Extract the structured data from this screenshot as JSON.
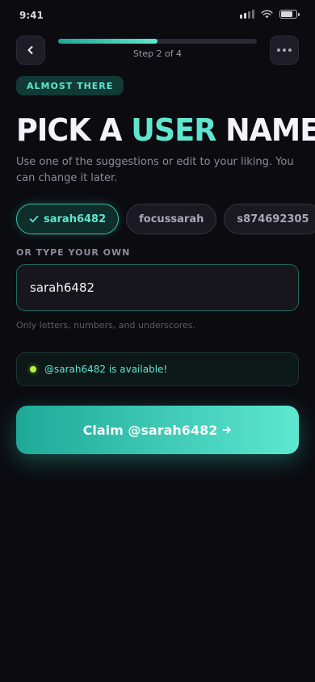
{
  "status_bar": {
    "time": "9:41"
  },
  "header": {
    "step_label": "Step 2 of 4",
    "progress_fraction": 0.5
  },
  "badge": {
    "label": "ALMOST THERE"
  },
  "title": {
    "part1": "PICK A ",
    "accent": "USER",
    "part2": " NAME"
  },
  "subtitle": "Use one of the suggestions or edit to your liking. You can change it later.",
  "suggestions": [
    {
      "label": "sarah6482",
      "selected": true
    },
    {
      "label": "focussarah",
      "selected": false
    },
    {
      "label": "s874692305",
      "selected": false
    }
  ],
  "custom": {
    "label": "OR TYPE YOUR OWN",
    "value": "sarah6482",
    "hint": "Only letters, numbers, and underscores."
  },
  "availability": {
    "text": "@sarah6482 is available!"
  },
  "cta": {
    "label": "Claim @sarah6482"
  },
  "icons": {
    "back": "chevron-left-icon",
    "more": "more-horizontal-icon",
    "check": "check-icon",
    "arrow": "arrow-right-icon"
  },
  "colors": {
    "background": "#0b0b10",
    "accent": "#5fe6cf",
    "available_dot": "#b6f23c"
  }
}
